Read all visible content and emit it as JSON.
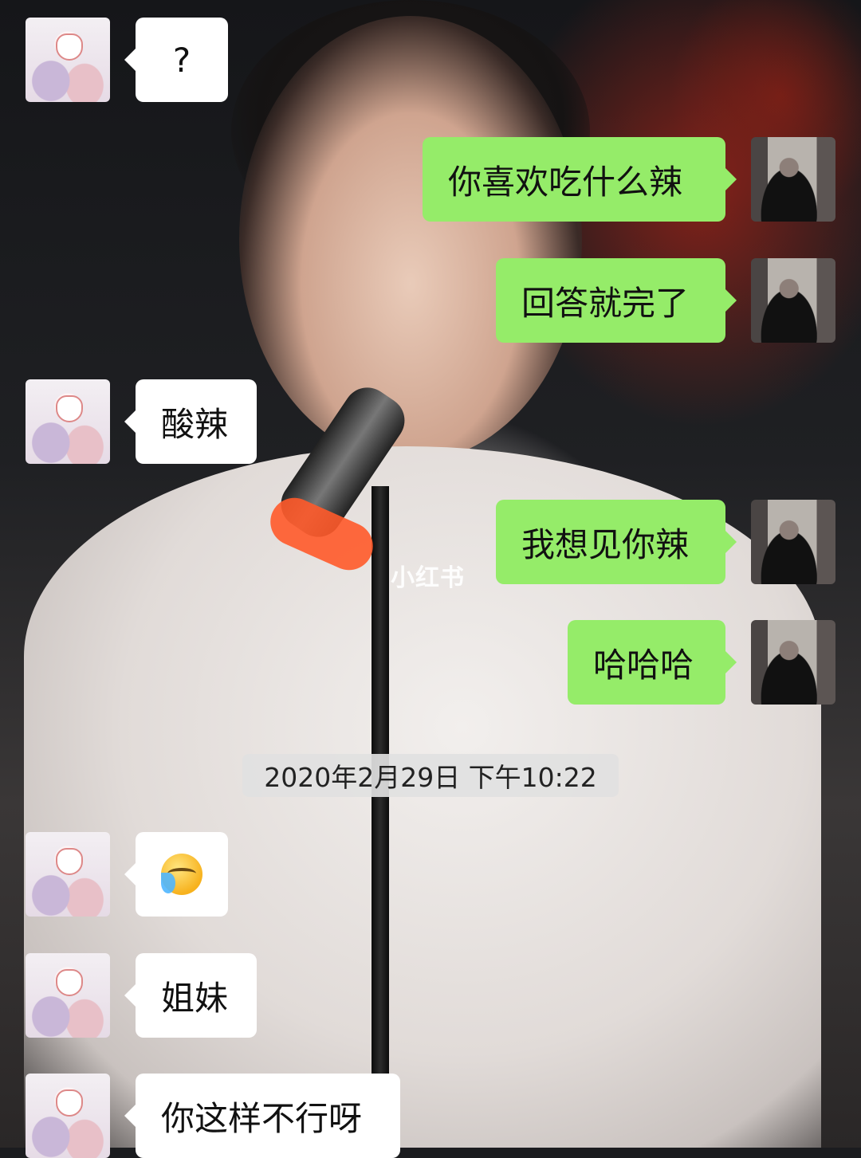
{
  "chat": {
    "watermark": "小红书",
    "timestamp": "2020年2月29日 下午10:22",
    "messages": [
      {
        "side": "left",
        "text": "?"
      },
      {
        "side": "right",
        "text": "你喜欢吃什么辣"
      },
      {
        "side": "right",
        "text": "回答就完了"
      },
      {
        "side": "left",
        "text": "酸辣"
      },
      {
        "side": "right",
        "text": "我想见你辣"
      },
      {
        "side": "right",
        "text": "哈哈哈"
      },
      {
        "side": "left",
        "emoji": "crying-laughing-emoji"
      },
      {
        "side": "left",
        "text": "姐妹"
      },
      {
        "side": "left",
        "text": "你这样不行呀"
      }
    ]
  }
}
